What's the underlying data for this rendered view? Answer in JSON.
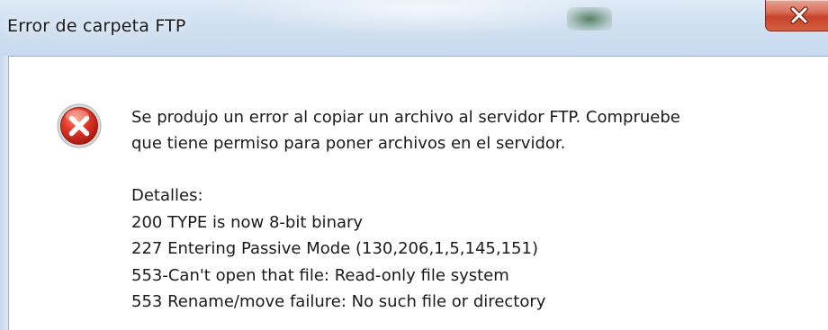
{
  "window": {
    "title": "Error de carpeta FTP",
    "close_glyph": "X"
  },
  "icons": {
    "error": "error-icon",
    "close": "close-icon"
  },
  "colors": {
    "error_red": "#c0201a",
    "close_button": "#c7432b",
    "title_bar": "#d3e2f2"
  },
  "message": {
    "line1": "Se produjo un error al copiar un archivo al servidor FTP. Compruebe",
    "line2": "que tiene permiso para poner archivos en el servidor."
  },
  "details": {
    "heading": "Detalles:",
    "lines": [
      "200 TYPE is now 8-bit binary",
      "227 Entering Passive Mode (130,206,1,5,145,151)",
      "553-Can't open that file: Read-only file system",
      "553 Rename/move failure: No such file or directory"
    ]
  }
}
